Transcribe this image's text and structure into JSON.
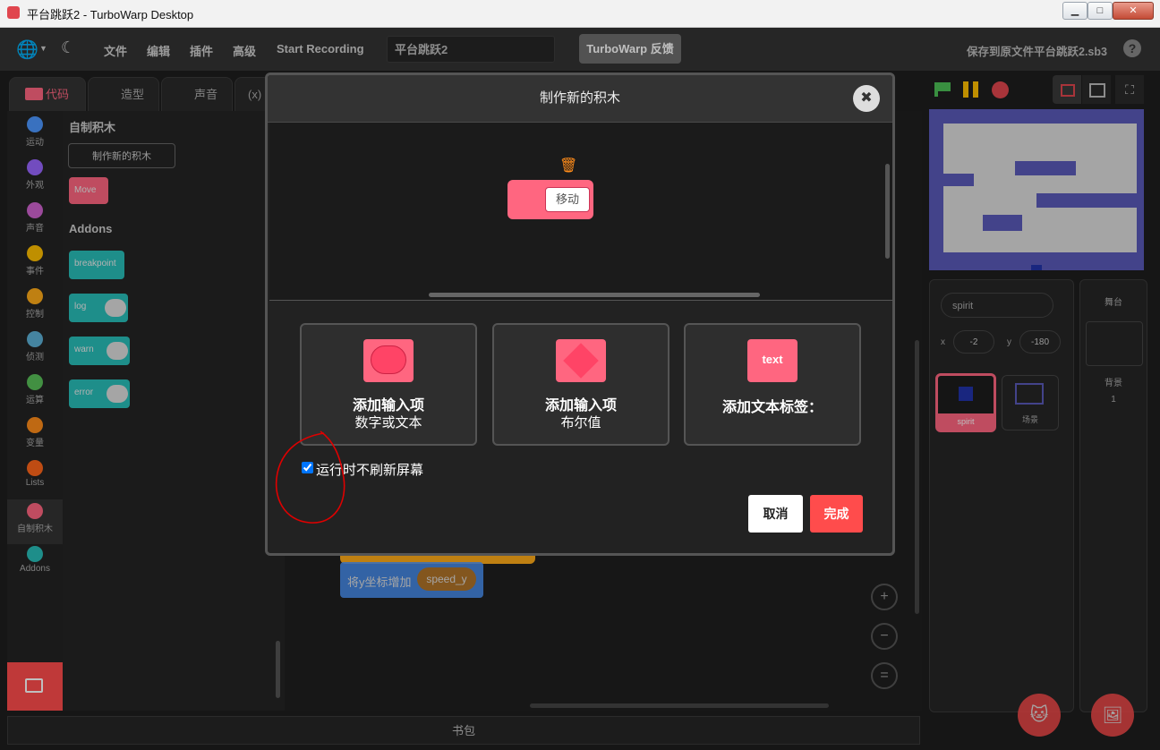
{
  "window": {
    "title": "平台跳跃2 - TurboWarp Desktop",
    "min": "▁",
    "max": "□",
    "close": "✕"
  },
  "menu": {
    "items": [
      "文件",
      "编辑",
      "插件",
      "高级",
      "Start Recording"
    ],
    "project_title": "平台跳跃2",
    "feedback": "TurboWarp 反馈",
    "save_status": "保存到原文件平台跳跃2.sb3",
    "help": "?"
  },
  "tabs": [
    {
      "label": "代码"
    },
    {
      "label": "造型"
    },
    {
      "label": "声音"
    },
    {
      "label": "(x)"
    }
  ],
  "categories": [
    {
      "label": "运动",
      "color": "#4c97ff"
    },
    {
      "label": "外观",
      "color": "#9966ff"
    },
    {
      "label": "声音",
      "color": "#cf63cf"
    },
    {
      "label": "事件",
      "color": "#ffbf00"
    },
    {
      "label": "控制",
      "color": "#ffab19"
    },
    {
      "label": "侦测",
      "color": "#5cb1d6"
    },
    {
      "label": "运算",
      "color": "#59c059"
    },
    {
      "label": "变量",
      "color": "#ff8c1a"
    },
    {
      "label": "Lists",
      "color": "#ff661a"
    },
    {
      "label": "自制积木",
      "color": "#ff6680"
    },
    {
      "label": "Addons",
      "color": "#29beb8"
    }
  ],
  "palette": {
    "heading": "自制积木",
    "make_block_button": "制作新的积木",
    "move_block": "Move",
    "addons_heading": "Addons",
    "addon_blocks": [
      "breakpoint",
      "log",
      "warn",
      "error"
    ]
  },
  "workspace": {
    "block_label": "将y坐标增加",
    "block_var": "speed_y",
    "bookbar": "书包"
  },
  "stage_panel": {
    "sprite_name": "spirit",
    "x_label": "x",
    "x_value": "-2",
    "y_label": "y",
    "y_value": "-180",
    "stage_label": "舞台",
    "backdrop_label": "背景",
    "backdrop_count": "1",
    "sprites": [
      "spirit",
      "场景"
    ]
  },
  "modal": {
    "title": "制作新的积木",
    "preview_block_label": "移动",
    "options": [
      {
        "line1": "添加输入项",
        "line2": "数字或文本",
        "icon": "number-text-input-icon"
      },
      {
        "line1": "添加输入项",
        "line2": "布尔值",
        "icon": "boolean-input-icon"
      },
      {
        "line1": "添加文本标签：",
        "line2": "",
        "icon_text": "text"
      }
    ],
    "checkbox_label": "运行时不刷新屏幕",
    "checkbox_checked": true,
    "cancel": "取消",
    "ok": "完成",
    "close": "✖"
  },
  "colors": {
    "accent": "#ff4c4c",
    "custom_block": "#ff6680",
    "annotation": "#e00000"
  }
}
